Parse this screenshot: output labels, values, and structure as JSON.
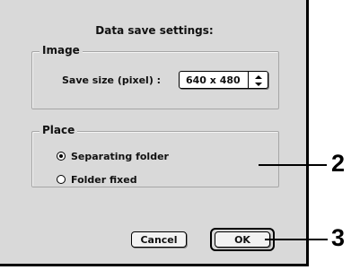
{
  "dialog": {
    "title": "Data save settings:",
    "image_group": {
      "legend": "Image",
      "save_size_label": "Save size (pixel) :",
      "save_size_value": "640 x 480"
    },
    "place_group": {
      "legend": "Place",
      "options": [
        {
          "label": "Separating folder",
          "selected": true
        },
        {
          "label": "Folder fixed",
          "selected": false
        }
      ]
    },
    "buttons": {
      "cancel": "Cancel",
      "ok": "OK"
    }
  },
  "callouts": {
    "place": "2",
    "ok": "3"
  }
}
